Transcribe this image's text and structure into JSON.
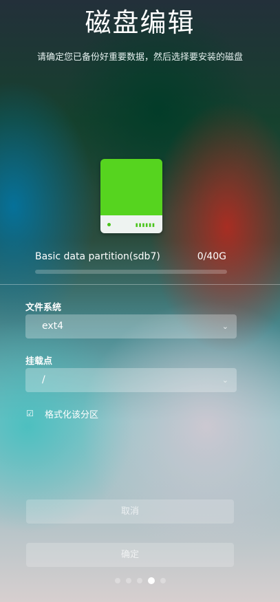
{
  "header": {
    "title": "磁盘编辑",
    "subtitle": "请确定您已备份好重要数据，然后选择要安装的磁盘"
  },
  "partition": {
    "label": "Basic data partition(sdb7)",
    "size": "0/40G",
    "usage_fraction": 0
  },
  "filesystem": {
    "label": "文件系统",
    "value": "ext4"
  },
  "mountpoint": {
    "label": "挂载点",
    "value": "/"
  },
  "format": {
    "checked": true,
    "label": "格式化该分区"
  },
  "buttons": {
    "cancel_label": "取消",
    "confirm_label": "确定"
  },
  "pager": {
    "total": 5,
    "current": 3
  },
  "colors": {
    "disk_green": "#56d41f"
  }
}
